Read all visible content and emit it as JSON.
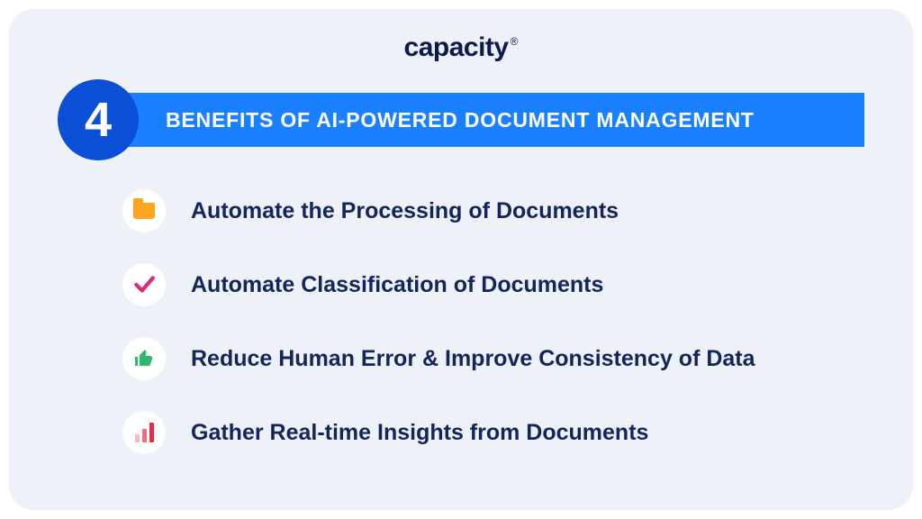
{
  "brand": {
    "name": "capacity",
    "registered": "®"
  },
  "header": {
    "count": "4",
    "title": "BENEFITS OF AI-POWERED DOCUMENT MANAGEMENT"
  },
  "items": [
    {
      "icon": "folder-icon",
      "label": "Automate the Processing of Documents"
    },
    {
      "icon": "check-icon",
      "label": "Automate Classification of Documents"
    },
    {
      "icon": "thumbs-up-icon",
      "label": "Reduce Human Error & Improve Consistency of Data"
    },
    {
      "icon": "bar-chart-icon",
      "label": "Gather Real-time Insights from Documents"
    }
  ],
  "colors": {
    "card_bg": "#eef1f7",
    "title_bar": "#1a80ff",
    "badge": "#0a4fd6",
    "text": "#12255c"
  }
}
